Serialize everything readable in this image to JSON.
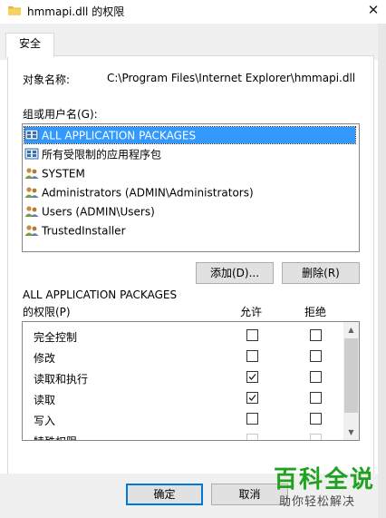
{
  "window": {
    "title": "hmmapi.dll 的权限",
    "close_glyph": "✕"
  },
  "tabs": [
    {
      "label": "安全"
    }
  ],
  "object": {
    "label": "对象名称:",
    "value": "C:\\Program Files\\Internet Explorer\\hmmapi.dll"
  },
  "group_label": "组或用户名(G):",
  "users": [
    {
      "name": "ALL APPLICATION PACKAGES",
      "icon": "app-package-icon",
      "selected": true
    },
    {
      "name": "所有受限制的应用程序包",
      "icon": "app-package-icon",
      "selected": false
    },
    {
      "name": "SYSTEM",
      "icon": "users-icon",
      "selected": false
    },
    {
      "name": "Administrators (ADMIN\\Administrators)",
      "icon": "users-icon",
      "selected": false
    },
    {
      "name": "Users (ADMIN\\Users)",
      "icon": "users-icon",
      "selected": false
    },
    {
      "name": "TrustedInstaller",
      "icon": "users-icon",
      "selected": false
    }
  ],
  "buttons": {
    "add": "添加(D)...",
    "remove": "删除(R)",
    "ok": "确定",
    "cancel": "取消"
  },
  "permissions": {
    "title_line1": "ALL APPLICATION PACKAGES",
    "title_line2": "的权限(P)",
    "allow_header": "允许",
    "deny_header": "拒绝",
    "rows": [
      {
        "name": "完全控制",
        "allow": false,
        "deny": false
      },
      {
        "name": "修改",
        "allow": false,
        "deny": false
      },
      {
        "name": "读取和执行",
        "allow": true,
        "deny": false
      },
      {
        "name": "读取",
        "allow": true,
        "deny": false
      },
      {
        "name": "写入",
        "allow": false,
        "deny": false
      },
      {
        "name": "特殊权限",
        "allow": false,
        "deny": false
      }
    ]
  },
  "watermark": {
    "main": "百科全说",
    "sub": "助你轻松解决"
  },
  "colors": {
    "selection": "#3399ff",
    "accent": "#0078d7",
    "watermark_green": "#1fa21f"
  }
}
